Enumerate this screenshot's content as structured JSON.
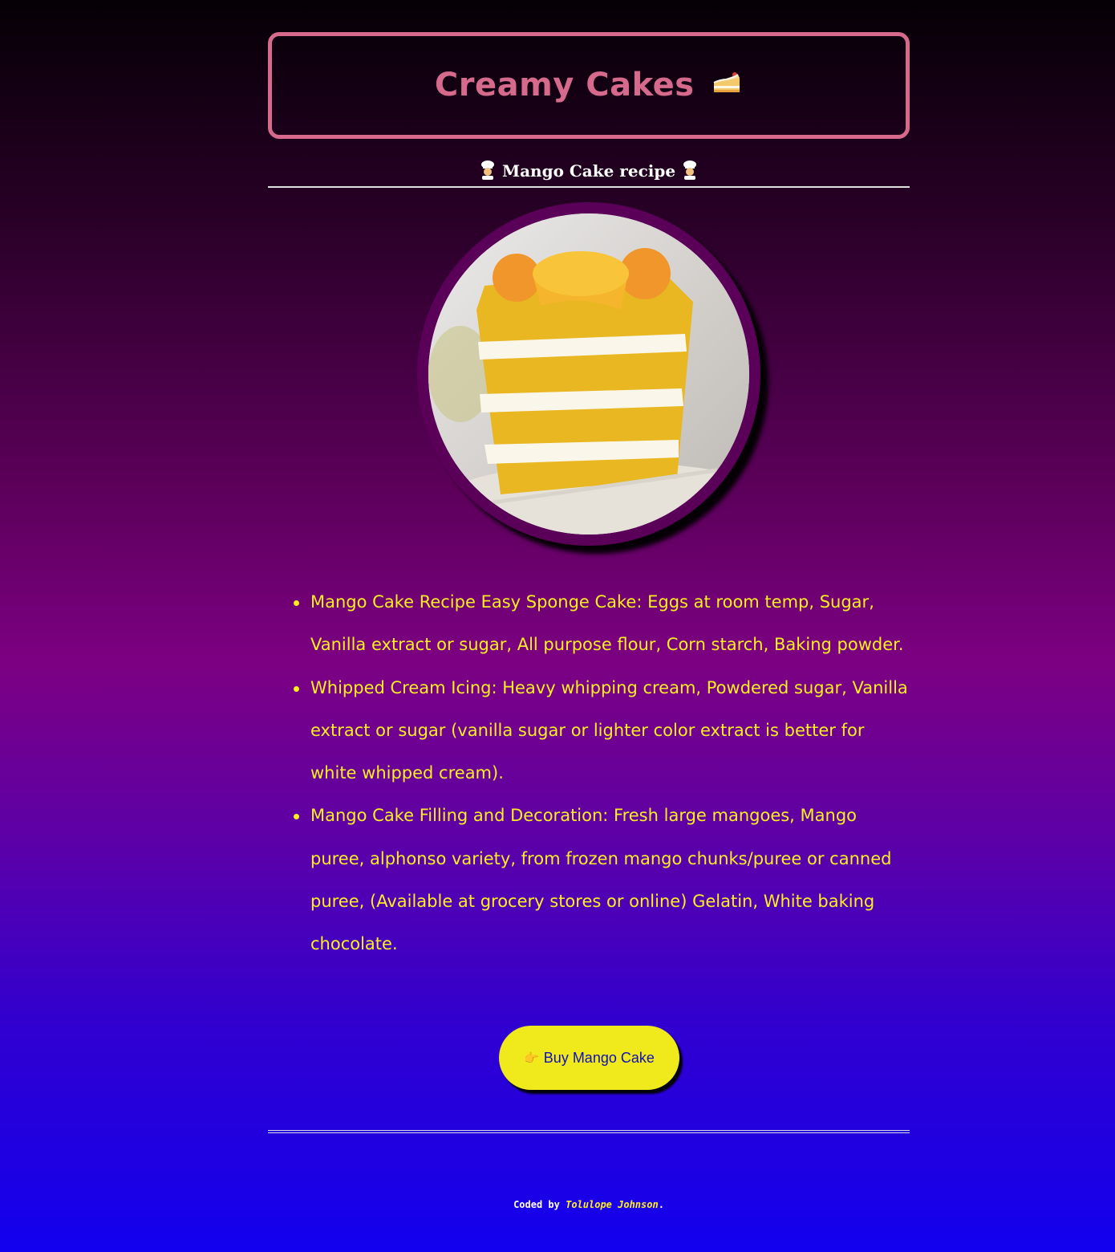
{
  "header": {
    "title": "Creamy Cakes",
    "title_icon": "cake-slice-icon"
  },
  "recipe": {
    "subtitle": "Mango Cake recipe",
    "subtitle_icon": "chef-icon"
  },
  "image": {
    "alt": "mango-cake-photo"
  },
  "ingredients": [
    "Mango Cake Recipe Easy Sponge Cake: Eggs at room temp, Sugar, Vanilla extract or sugar, All purpose flour, Corn starch, Baking powder.",
    "Whipped Cream Icing: Heavy whipping cream, Powdered sugar, Vanilla extract or sugar (vanilla sugar or lighter color extract is better for white whipped cream).",
    "Mango Cake Filling and Decoration: Fresh large mangoes, Mango puree, alphonso variety, from frozen mango chunks/puree or canned puree, (Available at grocery stores or online) Gelatin, White baking chocolate."
  ],
  "buy_button": {
    "label": "Buy Mango Cake",
    "icon": "pointing-hand-icon"
  },
  "footer": {
    "prefix": "Coded by ",
    "author": "Tolulope Johnson",
    "suffix": "."
  },
  "colors": {
    "accent_pink": "#d66a8c",
    "text_yellow": "#ffee22",
    "button_yellow": "#f0ea1c",
    "button_text": "#1010b8"
  }
}
